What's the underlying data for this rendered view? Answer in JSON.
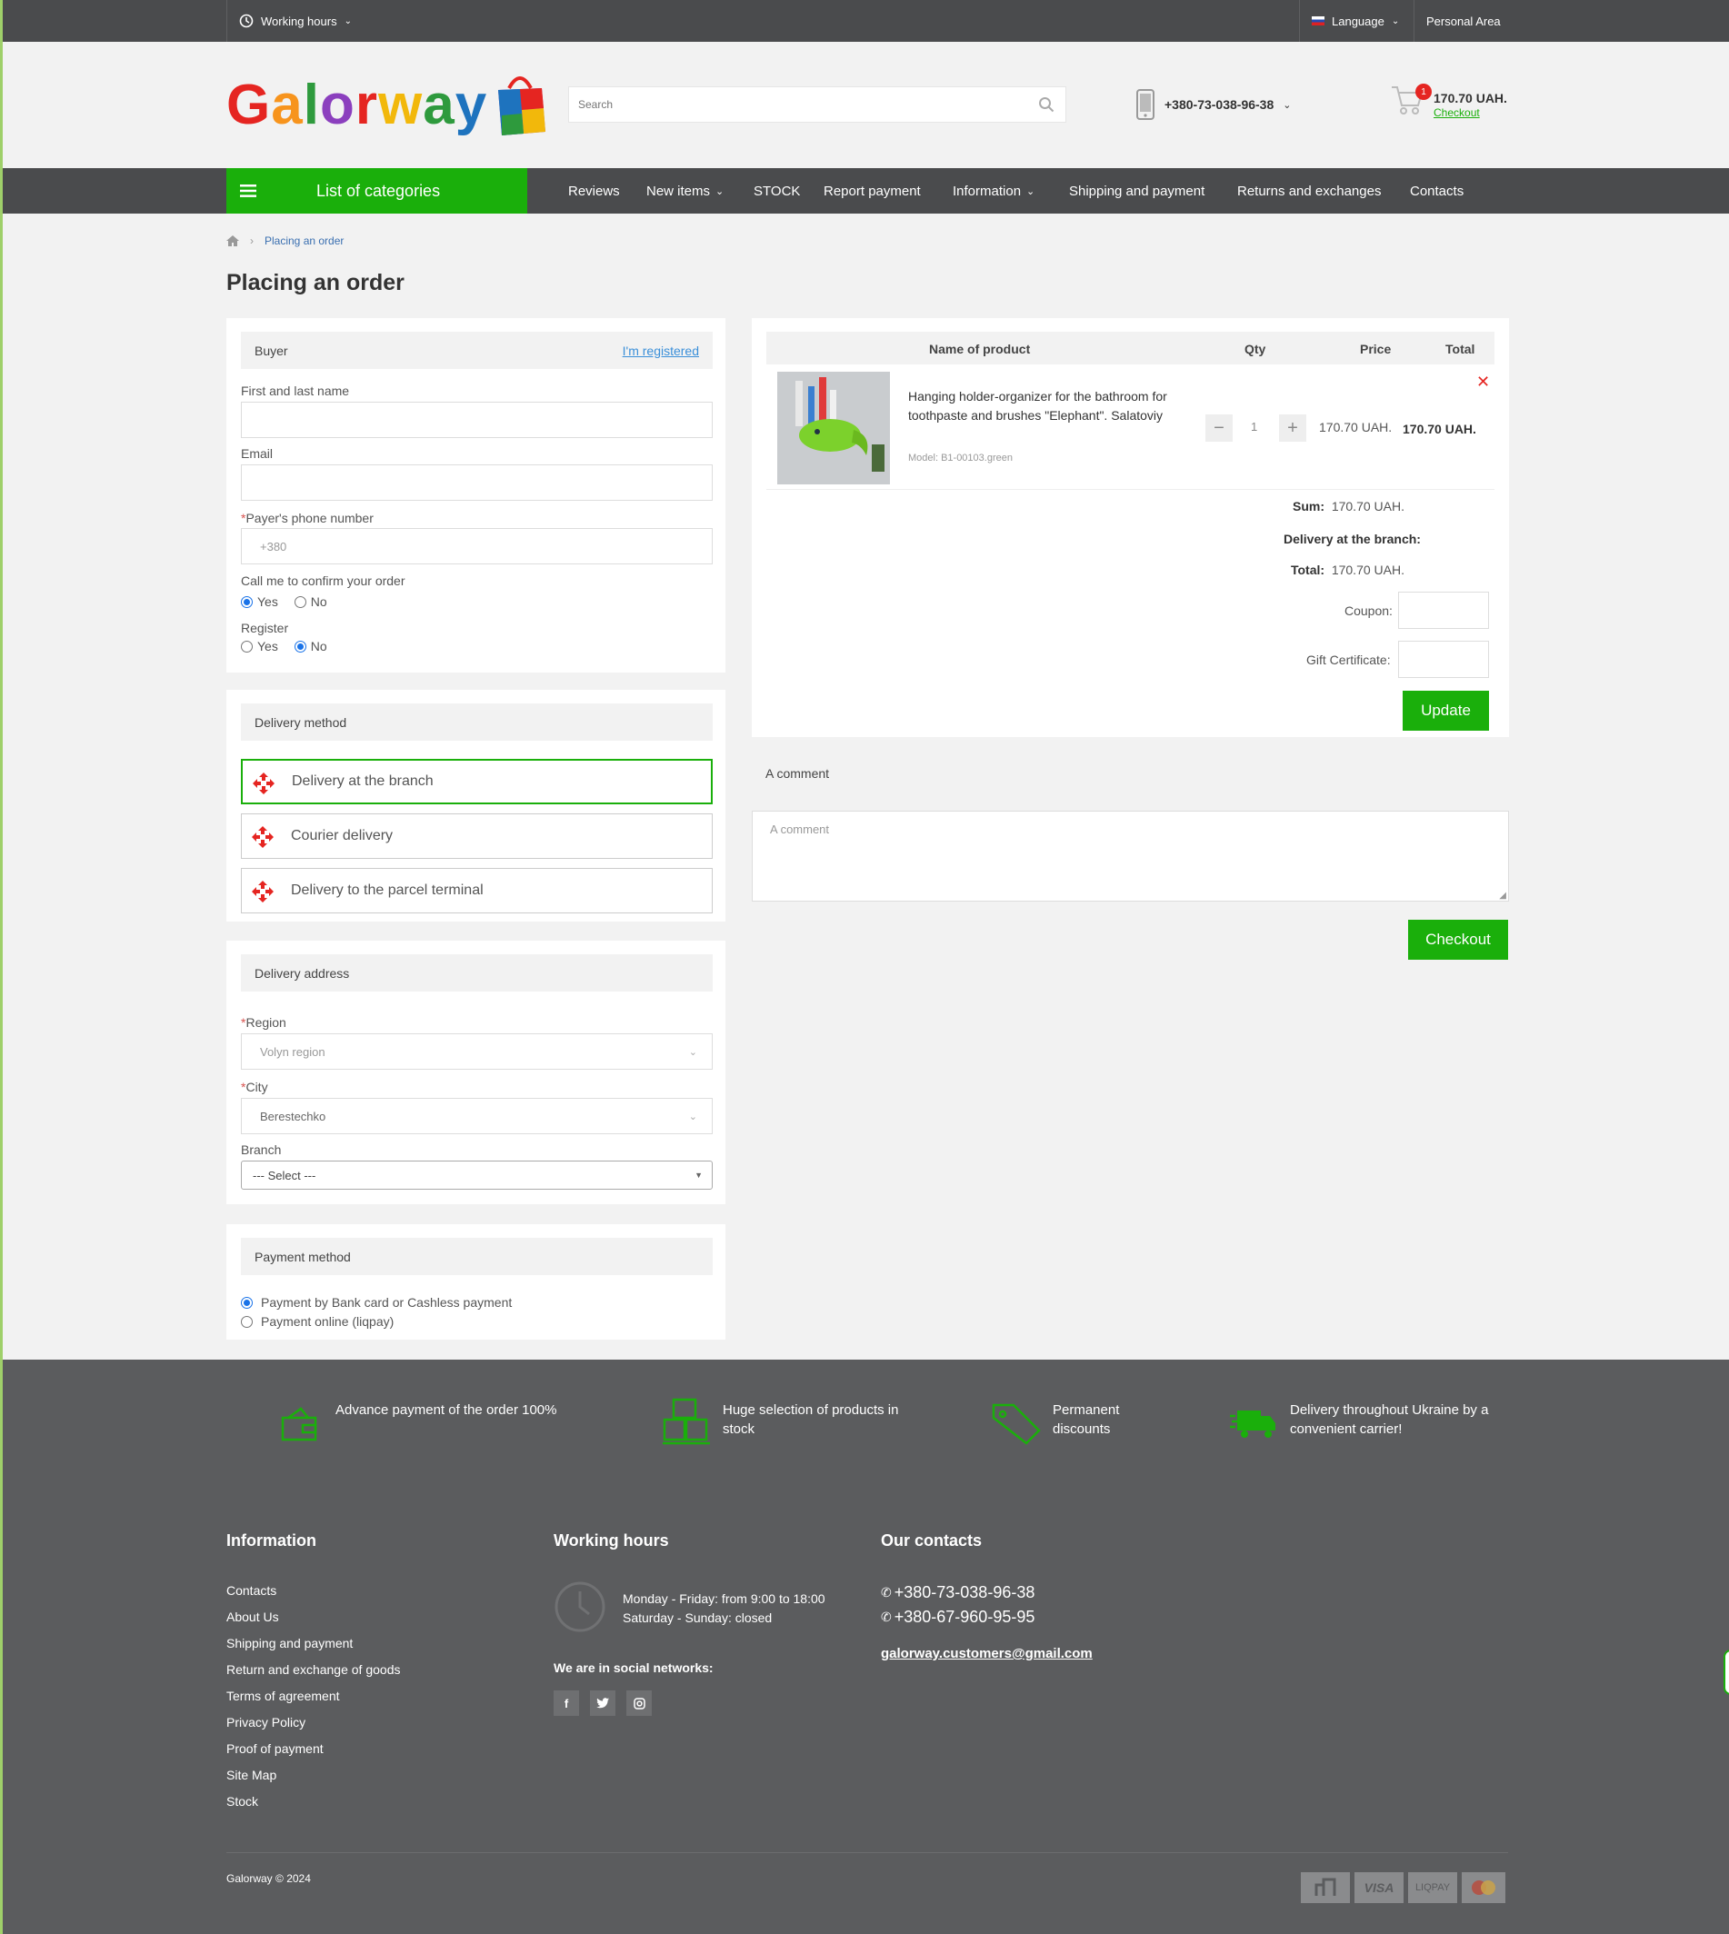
{
  "topbar": {
    "working_hours": "Working hours",
    "language": "Language",
    "personal_area": "Personal Area"
  },
  "header": {
    "logo_letters": [
      "G",
      "a",
      "l",
      "o",
      "r",
      "w",
      "a",
      "y"
    ],
    "logo_colors": [
      "#e52521",
      "#f7941d",
      "#2e9a3d",
      "#8b3fbe",
      "#e52521",
      "#f2b80b",
      "#2e9a3d",
      "#1e73be"
    ],
    "search_placeholder": "Search",
    "phone": "+380-73-038-96-38",
    "cart_count": "1",
    "cart_total": "170.70 UAH.",
    "cart_checkout": "Checkout"
  },
  "nav": {
    "categories": "List of categories",
    "items": [
      "Reviews",
      "New items",
      "STOCK",
      "Report payment",
      "Information",
      "Shipping and payment",
      "Returns and exchanges",
      "Contacts"
    ]
  },
  "breadcrumb": {
    "current": "Placing an order"
  },
  "page_title": "Placing an order",
  "buyer": {
    "heading": "Buyer",
    "registered_link": "I'm registered",
    "name_label": "First and last name",
    "email_label": "Email",
    "phone_label": "Payer's phone number",
    "phone_placeholder": "+380",
    "call_label": "Call me to confirm your order",
    "yes": "Yes",
    "no": "No",
    "register_label": "Register"
  },
  "delivery": {
    "heading": "Delivery method",
    "options": [
      "Delivery at the branch",
      "Courier delivery",
      "Delivery to the parcel terminal"
    ]
  },
  "address": {
    "heading": "Delivery address",
    "region_label": "Region",
    "region_value": "Volyn region",
    "city_label": "City",
    "city_value": "Berestechko",
    "branch_label": "Branch",
    "branch_value": "--- Select ---"
  },
  "payment": {
    "heading": "Payment method",
    "options": [
      "Payment by Bank card or Cashless payment",
      "Payment online (liqpay)"
    ]
  },
  "cart": {
    "col_name": "Name of product",
    "col_qty": "Qty",
    "col_price": "Price",
    "col_total": "Total",
    "product_name": "Hanging holder-organizer for the bathroom for toothpaste and brushes \"Elephant\". Salatoviy",
    "product_model": "Model: B1-00103.green",
    "qty": "1",
    "price": "170.70 UAH.",
    "total": "170.70 UAH.",
    "sum_label": "Sum:",
    "sum_value": "170.70 UAH.",
    "delivery_label": "Delivery at the branch:",
    "total_label": "Total:",
    "total_value": "170.70 UAH.",
    "coupon_label": "Coupon:",
    "gift_label": "Gift Certificate:",
    "update": "Update"
  },
  "comment": {
    "heading": "A comment",
    "placeholder": "A comment",
    "checkout": "Checkout"
  },
  "footer": {
    "features": [
      "Advance payment of the order 100%",
      "Huge selection of products in stock",
      "Permanent discounts",
      "Delivery throughout Ukraine by a convenient carrier!"
    ],
    "info_heading": "Information",
    "info_links": [
      "Contacts",
      "About Us",
      "Shipping and payment",
      "Return and exchange of goods",
      "Terms of agreement",
      "Privacy Policy",
      "Proof of payment",
      "Site Map",
      "Stock"
    ],
    "hours_heading": "Working hours",
    "hours_line1": "Monday - Friday: from 9:00 to 18:00",
    "hours_line2": "Saturday - Sunday: closed",
    "social_heading": "We are in social networks:",
    "contacts_heading": "Our contacts",
    "phone1": "+380-73-038-96-38",
    "phone2": "+380-67-960-95-95",
    "email": "galorway.customers@gmail.com",
    "copyright": "Galorway © 2024",
    "payment_badges": [
      "VISA",
      "LIQPAY"
    ]
  },
  "colors": {
    "accent": "#1aaf0b",
    "dark": "#4a4b4d",
    "footer": "#5b5c5e",
    "link": "#3a6fb0"
  }
}
